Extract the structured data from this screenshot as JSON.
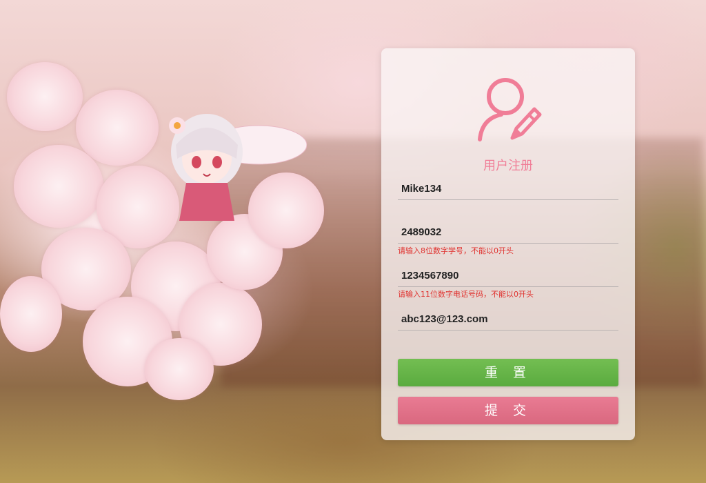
{
  "form": {
    "title": "用户注册",
    "fields": {
      "username": {
        "value": "Mike134"
      },
      "student_id": {
        "value": "2489032",
        "hint": "请输入8位数字学号，不能以0开头"
      },
      "phone": {
        "value": "1234567890",
        "hint": "请输入11位数字电话号码，不能以0开头"
      },
      "email": {
        "value": "abc123@123.com"
      }
    },
    "buttons": {
      "reset": "重 置",
      "submit": "提 交"
    }
  },
  "icons": {
    "header": "user-edit-icon"
  },
  "colors": {
    "accent": "#f07d97",
    "reset_button": "#66b548",
    "submit_button": "#e07088",
    "error_text": "#e0322f"
  }
}
